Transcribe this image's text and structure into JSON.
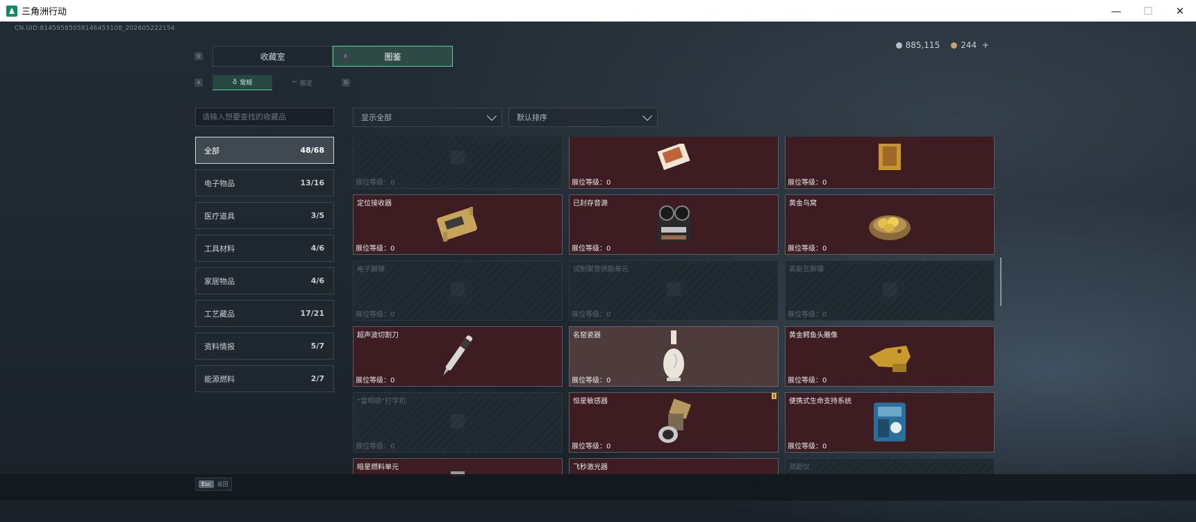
{
  "window": {
    "title": "三角洲行动",
    "controls": [
      "—",
      "☐",
      "✕"
    ]
  },
  "header": {
    "uid": "CN.UID:8145958505814645310​8_202605222154",
    "currency": {
      "silver": "885,115",
      "gold": "244",
      "add": "+"
    }
  },
  "tabs": {
    "key_left": "Q",
    "key_right": "E",
    "main": [
      {
        "label": "收藏室",
        "active": false
      },
      {
        "label": "图鉴",
        "active": true
      }
    ],
    "sub_key_left": "A",
    "sub_key_right": "D",
    "sub": [
      {
        "label": "常规",
        "icon": "♁",
        "active": true
      },
      {
        "label": "限定",
        "icon": "✂",
        "active": false
      }
    ]
  },
  "search": {
    "placeholder": "请输入想要查找的收藏品"
  },
  "filters": {
    "show": "显示全部",
    "sort": "默认排序"
  },
  "categories": [
    {
      "label": "全部",
      "count": "48/68",
      "active": true
    },
    {
      "label": "电子物品",
      "count": "13/16"
    },
    {
      "label": "医疗道具",
      "count": "3/5"
    },
    {
      "label": "工具材料",
      "count": "4/6"
    },
    {
      "label": "家居物品",
      "count": "4/6"
    },
    {
      "label": "工艺藏品",
      "count": "17/21"
    },
    {
      "label": "资料情报",
      "count": "5/7"
    },
    {
      "label": "能源燃料",
      "count": "2/7"
    }
  ],
  "level_label": "展位等级：",
  "items": [
    {
      "name": "",
      "level": "0",
      "locked": true,
      "icon": "wrench-icon"
    },
    {
      "name": "",
      "level": "0",
      "locked": false,
      "icon": "painting-icon"
    },
    {
      "name": "",
      "level": "0",
      "locked": false,
      "icon": "gold-frame-icon"
    },
    {
      "name": "定位接收器",
      "level": "0",
      "locked": false,
      "icon": "receiver-icon"
    },
    {
      "name": "已封存音源",
      "level": "0",
      "locked": false,
      "icon": "tape-recorder-icon"
    },
    {
      "name": "黄金鸟窝",
      "level": "0",
      "locked": false,
      "icon": "golden-nest-icon"
    },
    {
      "name": "电子脚镣",
      "level": "0",
      "locked": true,
      "icon": "ankle-monitor-icon"
    },
    {
      "name": "试制聚变供能单元",
      "level": "0",
      "locked": true,
      "icon": "fusion-cell-icon"
    },
    {
      "name": "高能瓦斯罐",
      "level": "0",
      "locked": true,
      "icon": "gas-canister-icon"
    },
    {
      "name": "超声波切割刀",
      "level": "0",
      "locked": false,
      "icon": "cutter-icon"
    },
    {
      "name": "名窑瓷器",
      "level": "0",
      "locked": false,
      "highlight": true,
      "icon": "vase-icon"
    },
    {
      "name": "黄金鳄鱼头雕像",
      "level": "0",
      "locked": false,
      "icon": "croc-statue-icon"
    },
    {
      "name": "“雷明顿”打字机",
      "level": "0",
      "locked": true,
      "icon": "typewriter-icon"
    },
    {
      "name": "恒星敏感器",
      "level": "0",
      "locked": false,
      "badge": "!",
      "icon": "star-sensor-icon"
    },
    {
      "name": "便携式生命支持系统",
      "level": "0",
      "locked": false,
      "icon": "life-support-icon"
    },
    {
      "name": "暗星燃料单元",
      "level": "",
      "locked": false,
      "icon": "fuel-cell-icon"
    },
    {
      "name": "飞秒激光器",
      "level": "",
      "locked": false,
      "icon": "laser-icon"
    },
    {
      "name": "测距仪",
      "level": "",
      "locked": true,
      "icon": "rangefinder-icon"
    }
  ],
  "footer": {
    "esc_key": "Esc",
    "esc_label": "返回"
  }
}
